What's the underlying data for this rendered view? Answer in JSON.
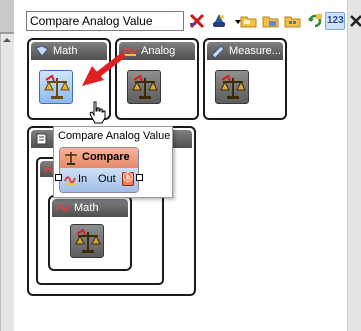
{
  "toolbar": {
    "search_value": "Compare Analog Value",
    "badge_123": "123",
    "icons": [
      "red-x-filter-icon",
      "blue-wizard-icon",
      "dropdown-arrow-icon",
      "folder-open-icon",
      "folder-copy-icon",
      "folder-grid-icon",
      "refresh-icon",
      "numeric-123-icon",
      "close-x-icon"
    ]
  },
  "blocks": [
    {
      "title": "Math"
    },
    {
      "title": "Analog"
    },
    {
      "title": "Measure..."
    },
    {
      "title": ""
    }
  ],
  "nested": {
    "inner_title": "Math"
  },
  "tooltip": {
    "title": "Compare Analog Value",
    "node_label": "Compare",
    "in_label": "In",
    "out_label": "Out"
  },
  "colors": {
    "header_gradient_top": "#7f7f7f",
    "header_gradient_bottom": "#4f4f4f",
    "selection_blue": "#8fb8ee",
    "compare_orange": "#e8896a",
    "pointer_red": "#e02020"
  }
}
